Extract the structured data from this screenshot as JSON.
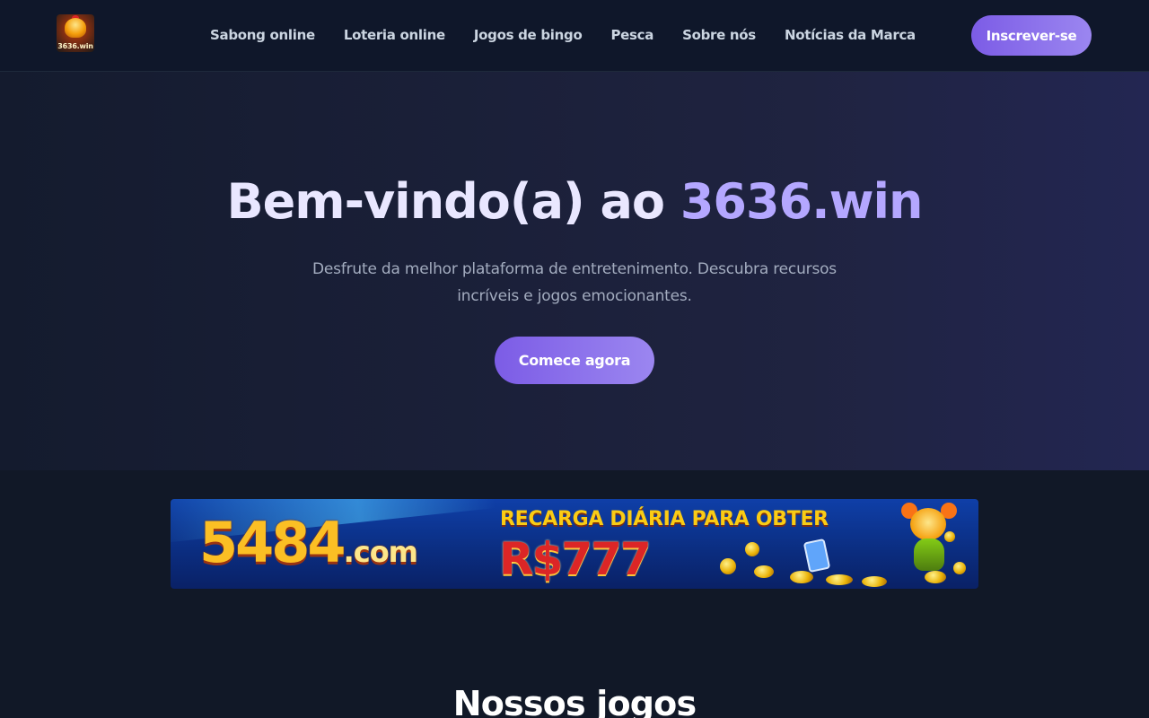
{
  "header": {
    "logo_text": "3636.win",
    "nav": [
      "Sabong online",
      "Loteria online",
      "Jogos de bingo",
      "Pesca",
      "Sobre nós",
      "Notícias da Marca"
    ],
    "signup_label": "Inscrever-se"
  },
  "hero": {
    "title_prefix": "Bem-vindo(a) ao ",
    "title_brand": "3636.win",
    "subtitle": "Desfrute da melhor plataforma de entretenimento. Descubra recursos incríveis e jogos emocionantes.",
    "cta_label": "Comece agora"
  },
  "banner": {
    "domain_main": "5484",
    "domain_suffix": ".com",
    "line1": "RECARGA DIÁRIA PARA OBTER",
    "line2": "R$777"
  },
  "games_section": {
    "title": "Nossos jogos"
  },
  "colors": {
    "accent": "#8b73ef",
    "background": "#111827",
    "header_bg": "#0f172a"
  }
}
